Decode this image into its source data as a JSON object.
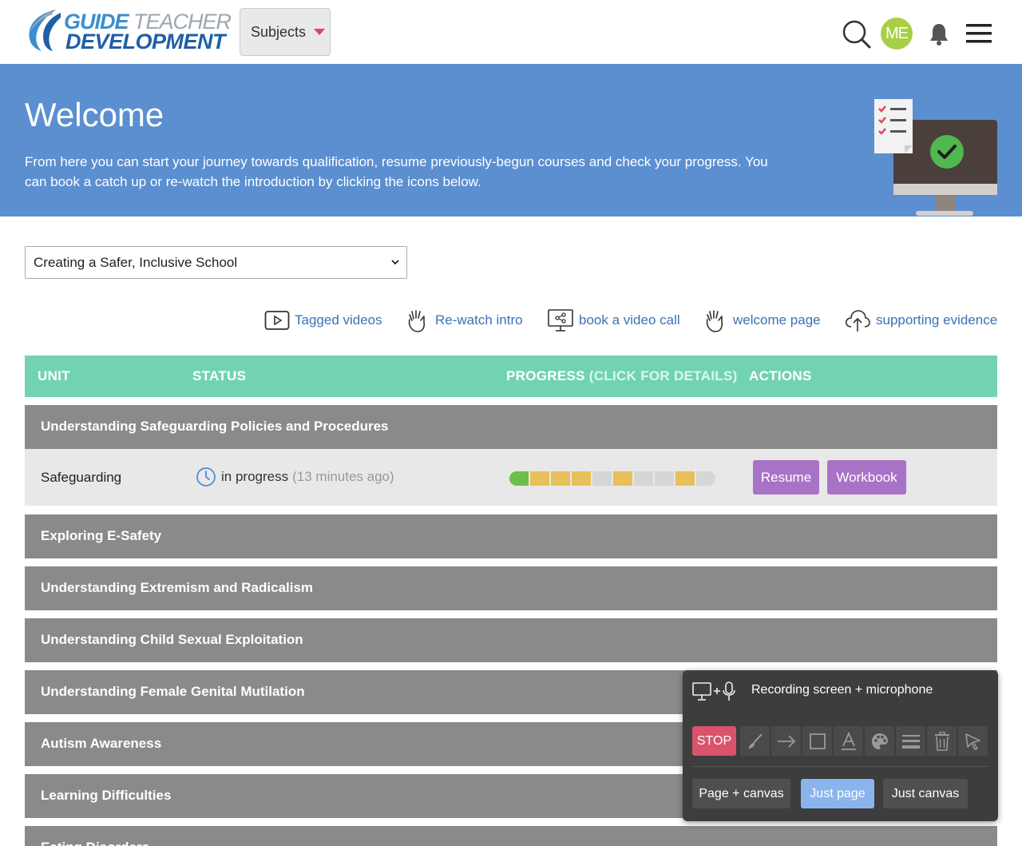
{
  "brand": {
    "line1_bold": "GUIDE",
    "line1_thin": "TEACHER",
    "line2": "DEVELOPMENT"
  },
  "header": {
    "subjects_label": "Subjects",
    "avatar_initials": "ME",
    "icons": [
      "search-icon",
      "bell-icon",
      "hamburger-menu-icon"
    ]
  },
  "hero": {
    "title": "Welcome",
    "text": "From here you can start your journey towards qualification, resume previously-begun courses and check your progress. You can book a catch up or re-watch the introduction by clicking the icons below."
  },
  "course_select": {
    "value": "Creating a Safer, Inclusive School"
  },
  "quick_links": [
    {
      "label": "Tagged videos",
      "icon": "video-play-icon"
    },
    {
      "label": "Re-watch intro",
      "icon": "waving-hand-icon"
    },
    {
      "label": "book a video call",
      "icon": "screen-share-icon"
    },
    {
      "label": "welcome page",
      "icon": "waving-hand-icon"
    },
    {
      "label": "supporting evidence",
      "icon": "cloud-upload-icon"
    }
  ],
  "table": {
    "col_unit": "UNIT",
    "col_status": "STATUS",
    "col_progress": "PROGRESS",
    "col_progress_hint": "(CLICK FOR DETAILS)",
    "col_actions": "ACTIONS"
  },
  "units": [
    {
      "title": "Understanding Safeguarding Policies and Procedures"
    },
    {
      "title": "Exploring E-Safety"
    },
    {
      "title": "Understanding Extremism and Radicalism"
    },
    {
      "title": "Understanding Child Sexual Exploitation"
    },
    {
      "title": "Understanding Female Genital Mutilation"
    },
    {
      "title": "Autism Awareness"
    },
    {
      "title": "Learning Difficulties"
    },
    {
      "title": "Eating Disorders"
    }
  ],
  "sub_unit": {
    "name": "Safeguarding",
    "status": "in progress",
    "status_ago": "(13 minutes ago)",
    "progress_segments": [
      "green",
      "yellow",
      "yellow",
      "yellow",
      "grey",
      "yellow",
      "grey",
      "grey",
      "yellow",
      "grey"
    ],
    "resume_label": "Resume",
    "workbook_label": "Workbook"
  },
  "recorder": {
    "title": "Recording screen + microphone",
    "stop_label": "STOP",
    "tools": [
      "brush-icon",
      "arrow-icon",
      "rectangle-icon",
      "text-icon",
      "palette-icon",
      "line-width-icon",
      "trash-icon",
      "cursor-icon"
    ],
    "options": [
      "Page + canvas",
      "Just page",
      "Just canvas"
    ],
    "active_option": "Just page"
  },
  "colors": {
    "hero_bg": "#5b8fd0",
    "table_header": "#72d3b3",
    "unit_row": "#8a8a8a",
    "accent_purple": "#a872c6",
    "progress_green": "#6cbf4b",
    "progress_yellow": "#e8c05a",
    "progress_grey": "#d6d6d6",
    "stop_red": "#d9536b"
  }
}
